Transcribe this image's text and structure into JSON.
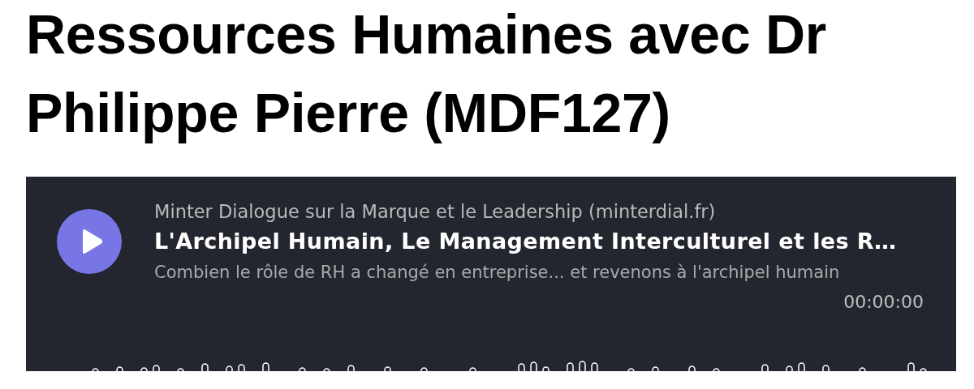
{
  "heading": "Ressources Humaines avec Dr Philippe Pierre (MDF127)",
  "player": {
    "podcast": "Minter Dialogue sur la Marque et le Leadership (minterdial.fr)",
    "episode": "L'Archipel Humain, Le Management Interculturel et les R…",
    "description": "Combien le rôle de RH a changé en entreprise... et revenons à l'archipel humain",
    "time": "00:00:00",
    "playing": false
  }
}
